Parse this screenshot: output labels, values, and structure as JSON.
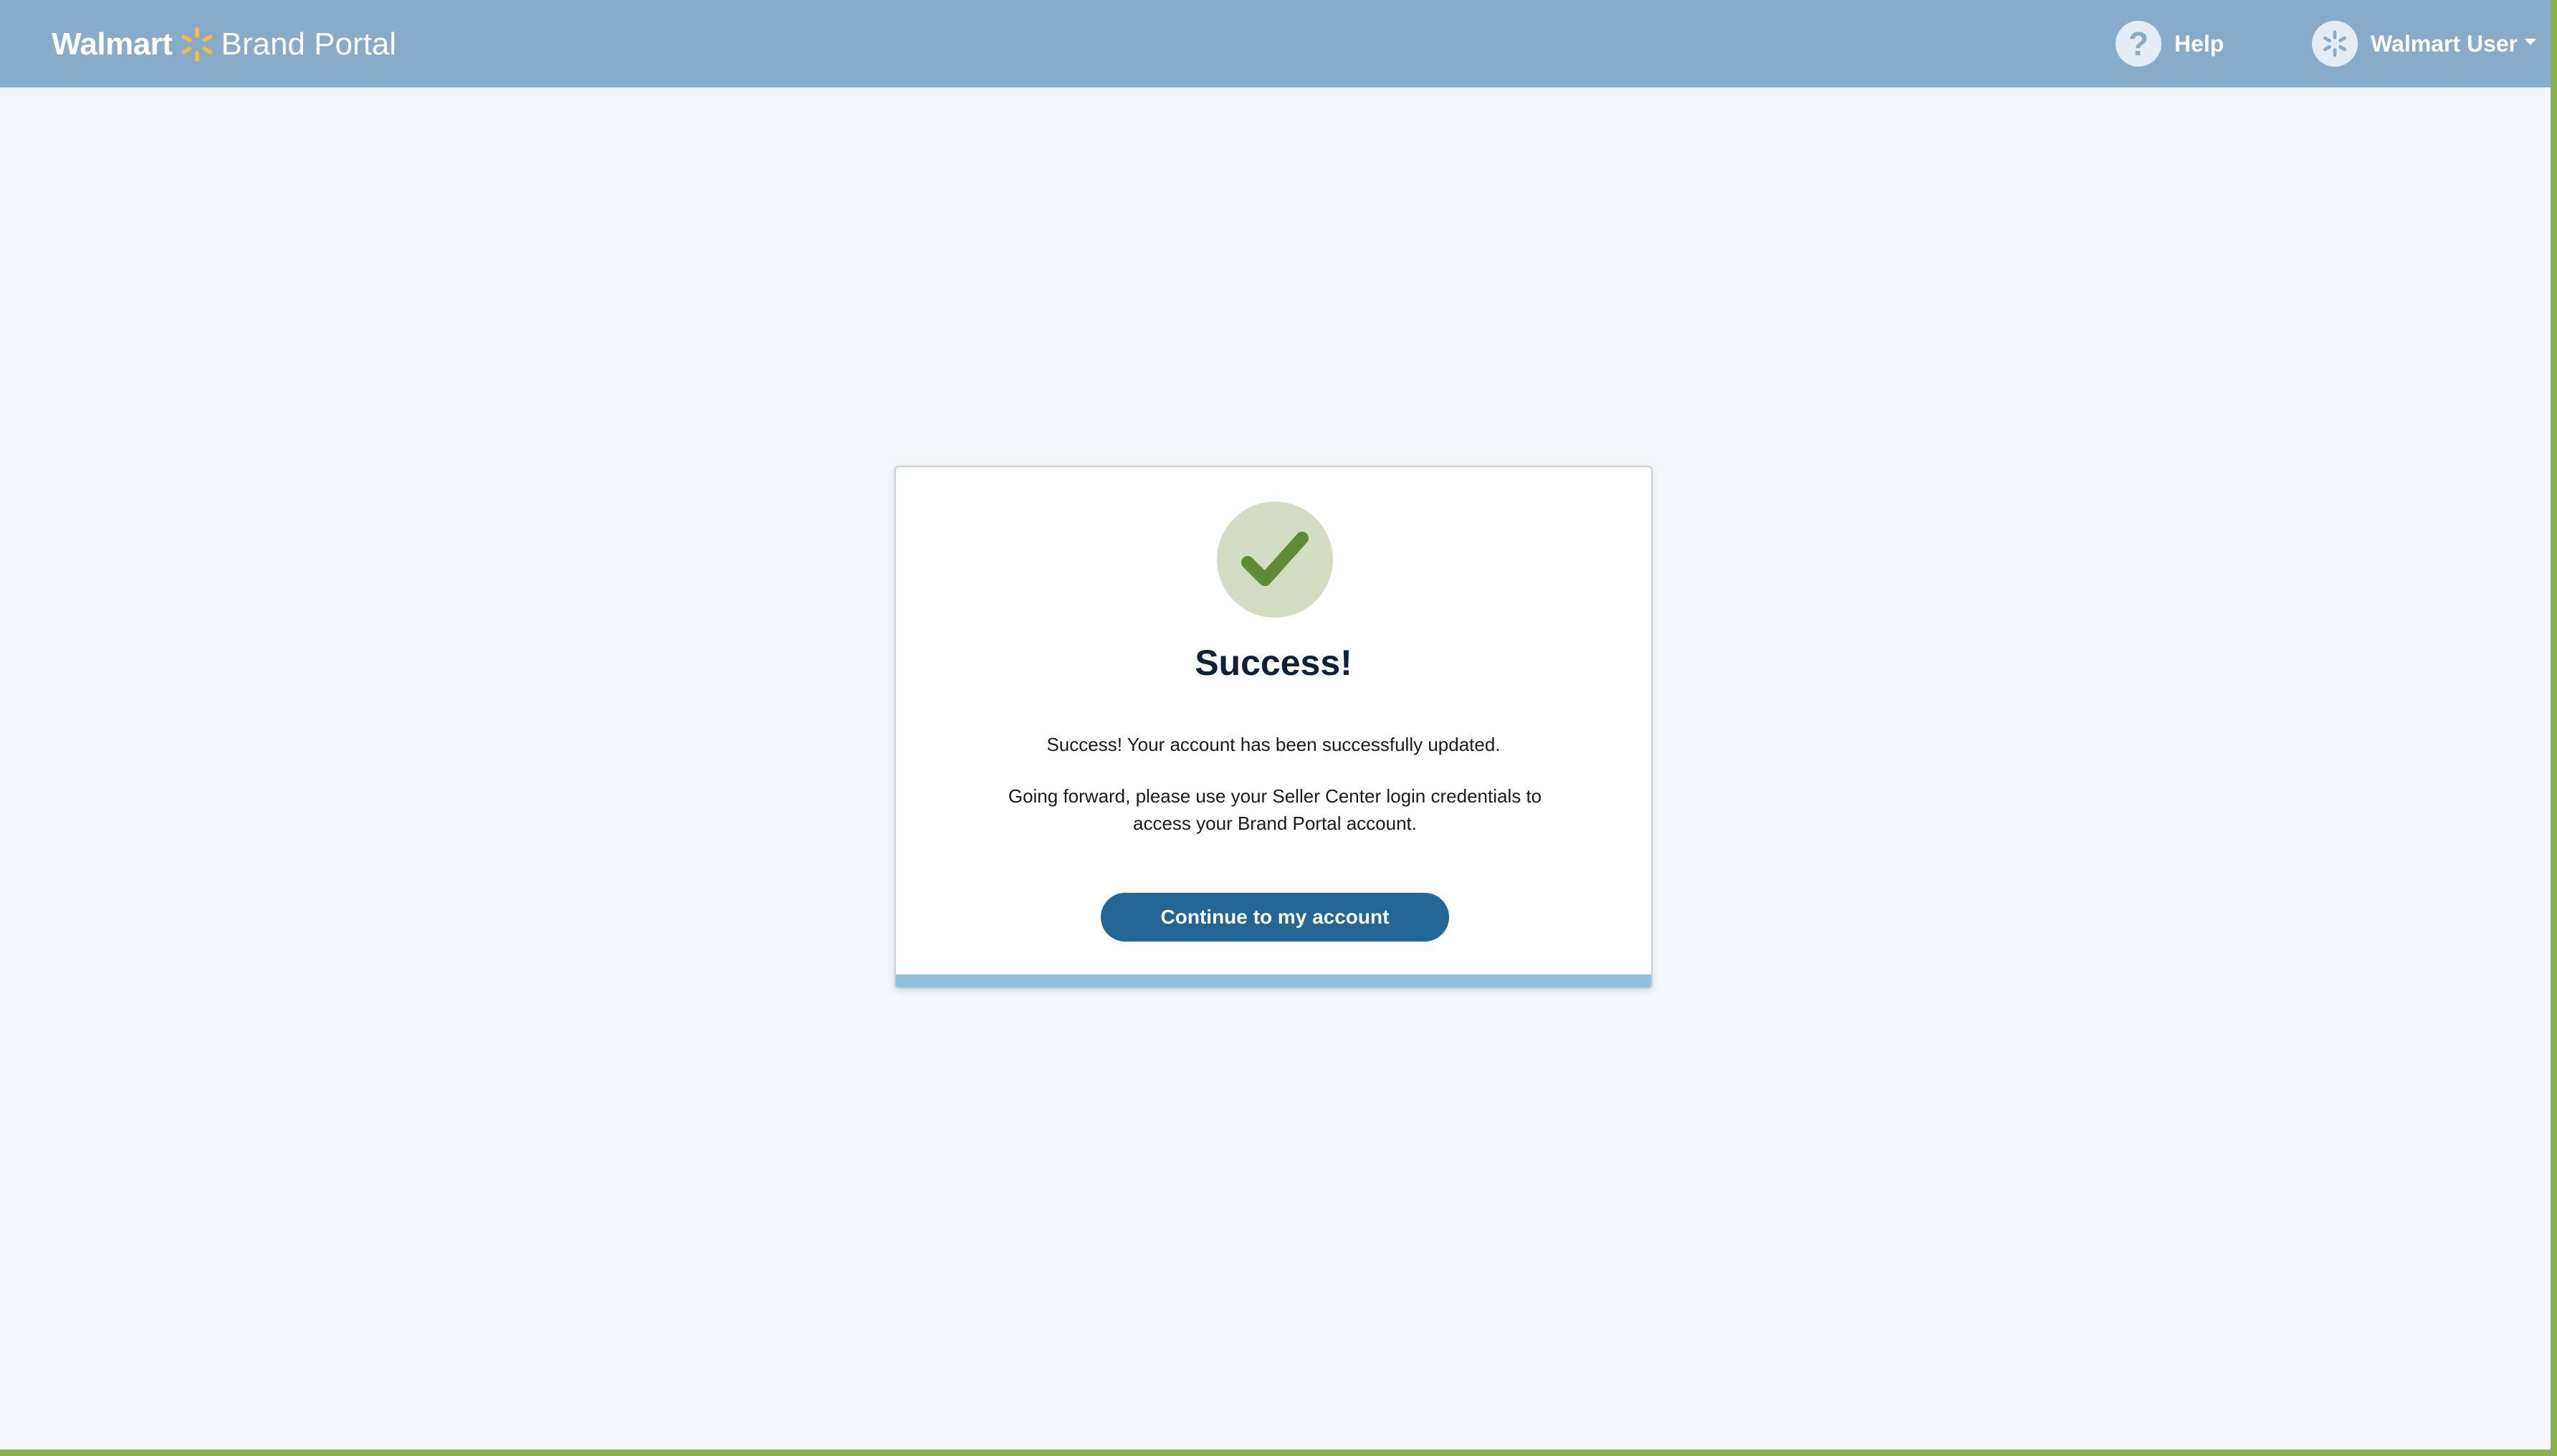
{
  "header": {
    "brand_name": "Walmart",
    "brand_product": "Brand Portal",
    "help_label": "Help",
    "user_name": "Walmart User"
  },
  "dialog": {
    "title": "Success!",
    "message_1": "Success! Your account has been successfully updated.",
    "message_2": "Going forward, please use your Seller Center login credentials to access your Brand Portal account.",
    "continue_label": "Continue to my account"
  },
  "icons": {
    "logo": "walmart-spark-icon",
    "help": "question-mark-icon",
    "avatar": "spark-avatar-icon",
    "user_menu": "caret-down-icon",
    "success": "checkmark-icon"
  },
  "colors": {
    "header": "#87abc9",
    "spark": "#f5b94a",
    "button": "#236594",
    "check_bg": "#d3ddc1",
    "check": "#5f8a37",
    "frame": "#8ab251"
  }
}
